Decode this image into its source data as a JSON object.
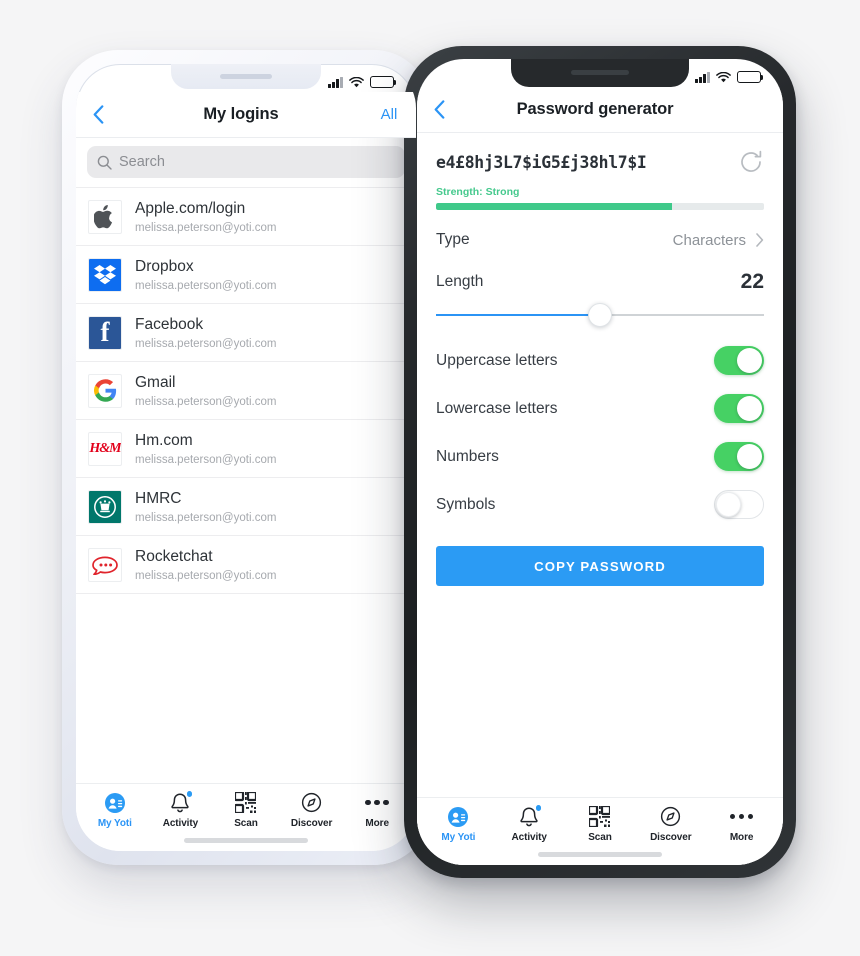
{
  "left_phone": {
    "frame_color": "#e8ebf2",
    "status_bar": {
      "signal": "signal-bars",
      "wifi": "wifi-icon",
      "battery": "battery-icon"
    },
    "nav": {
      "back": "chevron-left-icon",
      "title": "My logins",
      "action": "All"
    },
    "search": {
      "placeholder": "Search",
      "value": "",
      "icon": "search-icon"
    },
    "logins": [
      {
        "name": "Apple.com/login",
        "account": "melissa.peterson@yoti.com",
        "icon": "apple-icon"
      },
      {
        "name": "Dropbox",
        "account": "melissa.peterson@yoti.com",
        "icon": "dropbox-icon"
      },
      {
        "name": "Facebook",
        "account": "melissa.peterson@yoti.com",
        "icon": "facebook-icon"
      },
      {
        "name": "Gmail",
        "account": "melissa.peterson@yoti.com",
        "icon": "google-icon"
      },
      {
        "name": "Hm.com",
        "account": "melissa.peterson@yoti.com",
        "icon": "hm-icon"
      },
      {
        "name": "HMRC",
        "account": "melissa.peterson@yoti.com",
        "icon": "hmrc-icon"
      },
      {
        "name": "Rocketchat",
        "account": "melissa.peterson@yoti.com",
        "icon": "rocketchat-icon"
      }
    ],
    "tabs": [
      {
        "label": "My Yoti",
        "icon": "profile-icon",
        "active": true,
        "badge": false
      },
      {
        "label": "Activity",
        "icon": "bell-icon",
        "active": false,
        "badge": true
      },
      {
        "label": "Scan",
        "icon": "qr-icon",
        "active": false,
        "badge": false
      },
      {
        "label": "Discover",
        "icon": "compass-icon",
        "active": false,
        "badge": false
      },
      {
        "label": "More",
        "icon": "ellipsis-icon",
        "active": false,
        "badge": false
      }
    ]
  },
  "right_phone": {
    "frame_color": "#26292c",
    "status_bar": {
      "signal": "signal-bars",
      "wifi": "wifi-icon",
      "battery": "battery-icon"
    },
    "nav": {
      "back": "chevron-left-icon",
      "title": "Password generator"
    },
    "password": {
      "value": "e4£8hj3L7$iG5£j38hl7$I",
      "regenerate_icon": "refresh-icon",
      "strength_label": "Strength: Strong",
      "strength_percent": 72,
      "strength_color": "#3fc98a"
    },
    "type_row": {
      "label": "Type",
      "value": "Characters",
      "chevron": "chevron-right-icon"
    },
    "length_row": {
      "label": "Length",
      "value": "22",
      "slider_percent": 50,
      "accent": "#2b94f5"
    },
    "toggles": [
      {
        "label": "Uppercase letters",
        "on": true
      },
      {
        "label": "Lowercase letters",
        "on": true
      },
      {
        "label": "Numbers",
        "on": true
      },
      {
        "label": "Symbols",
        "on": false
      }
    ],
    "copy_button": {
      "label": "COPY PASSWORD",
      "color": "#2b9bf4"
    },
    "tabs": [
      {
        "label": "My Yoti",
        "icon": "profile-icon",
        "active": true,
        "badge": false
      },
      {
        "label": "Activity",
        "icon": "bell-icon",
        "active": false,
        "badge": true
      },
      {
        "label": "Scan",
        "icon": "qr-icon",
        "active": false,
        "badge": false
      },
      {
        "label": "Discover",
        "icon": "compass-icon",
        "active": false,
        "badge": false
      },
      {
        "label": "More",
        "icon": "ellipsis-icon",
        "active": false,
        "badge": false
      }
    ]
  },
  "theme": {
    "background": "#f5f5f6",
    "accent_blue": "#2b94f5",
    "toggle_green": "#46d164"
  }
}
